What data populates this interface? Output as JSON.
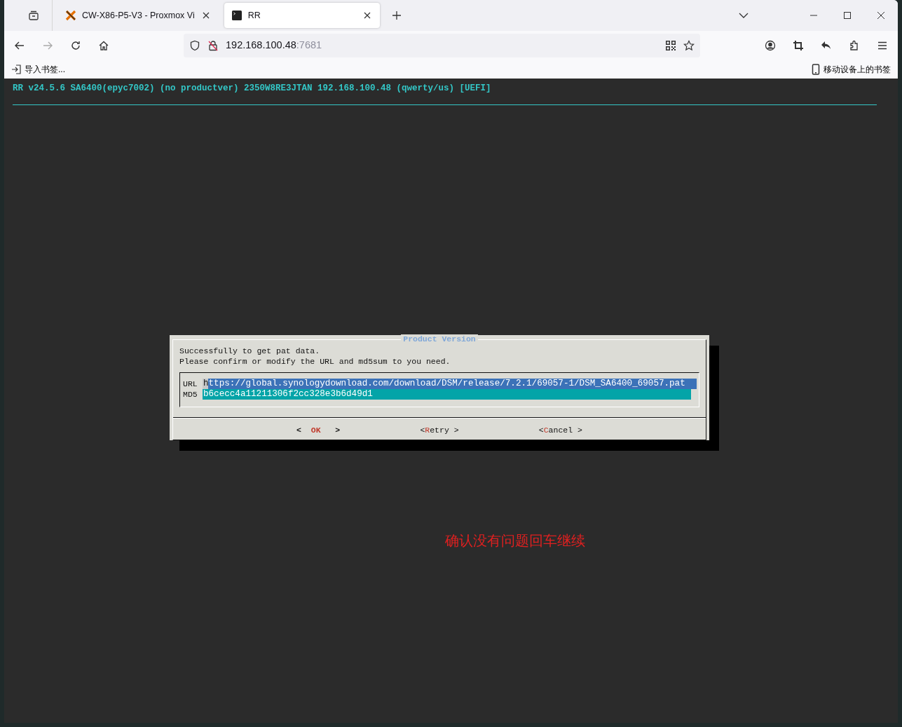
{
  "browser": {
    "tabs": [
      {
        "kind": "proxmox",
        "title": "CW-X86-P5-V3 - Proxmox Vi",
        "selected": false
      },
      {
        "kind": "terminal",
        "title": "RR",
        "selected": true
      }
    ],
    "address": {
      "host": "192.168.100.48",
      "port": ":7681"
    },
    "bookmarks": [
      {
        "kind": "import",
        "label": "导入书签..."
      },
      {
        "kind": "mobile",
        "label": "移动设备上的书签"
      }
    ]
  },
  "terminal": {
    "status_line": "RR v24.5.6 SA6400(epyc7002) (no productver) 2350W8RE3JTAN 192.168.100.48 (qwerty/us) [UEFI]",
    "dialog": {
      "title": "Product Version",
      "message": [
        "Successfully to get pat data.",
        "Please confirm or modify the URL and md5sum to you need."
      ],
      "fields": [
        {
          "label": "URL",
          "value": "https://global.synologydownload.com/download/DSM/release/7.2.1/69057-1/DSM_SA6400_69057.pat",
          "focused": true
        },
        {
          "label": "MD5",
          "value": "b6cecc4a11211306f2cc328e3b6d49d1",
          "focused": false
        }
      ],
      "buttons": [
        {
          "open": "<",
          "hotkey": "O",
          "rest": "K",
          "close": ">",
          "selected": true
        },
        {
          "open": "<",
          "hotkey": "R",
          "rest": "etry",
          "close": ">",
          "selected": false
        },
        {
          "open": "<",
          "hotkey": "C",
          "rest": "ancel",
          "close": ">",
          "selected": false
        }
      ]
    }
  },
  "annotation": "确认没有问题回车继续"
}
